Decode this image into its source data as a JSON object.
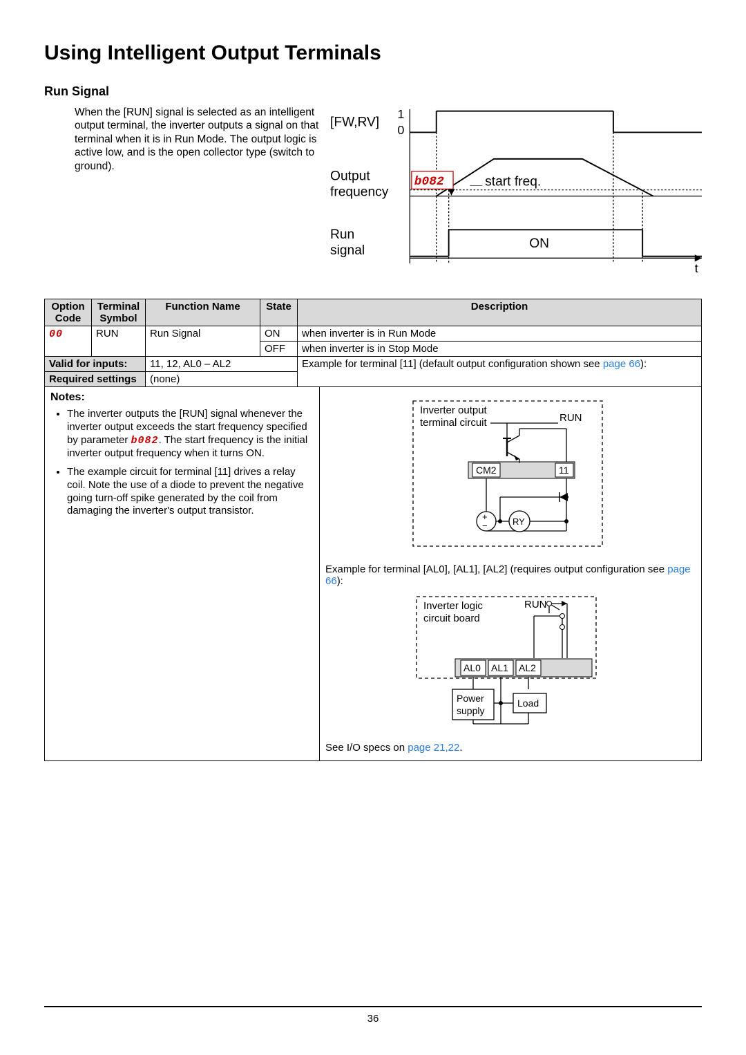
{
  "heading1": "Using Intelligent Output Terminals",
  "heading2": "Run Signal",
  "introText": "When the [RUN] signal is selected as an intelligent output terminal, the inverter outputs a signal on that terminal when it is in Run Mode. The output logic is active low, and is the open collector type (switch to ground).",
  "topDiagram": {
    "fwrv": "[FW,RV]",
    "one": "1",
    "zero": "0",
    "outputFreq": "Output frequency",
    "b082": "b082",
    "startFreq": "start freq.",
    "runSignal": "Run signal",
    "on": "ON",
    "t": "t"
  },
  "table": {
    "headers": {
      "optionCode": "Option Code",
      "terminalSymbol": "Terminal Symbol",
      "functionName": "Function Name",
      "state": "State",
      "description": "Description"
    },
    "row1": {
      "code": "00",
      "symbol": "RUN",
      "funcName": "Run Signal",
      "stateOn": "ON",
      "descOn": "when inverter is in Run Mode"
    },
    "row2": {
      "stateOff": "OFF",
      "descOff": "when inverter is in Stop Mode"
    },
    "validLabel": "Valid for inputs:",
    "validValue": "11, 12, AL0 – AL2",
    "reqLabel": "Required settings",
    "reqValue": "(none)",
    "exampleText1a": "Example for terminal [11] (default output configuration shown see ",
    "exampleText1b": "page 66",
    "exampleText1c": "):"
  },
  "notes": {
    "label": "Notes:",
    "n1a": "The inverter outputs the [RUN] signal whenever the inverter output exceeds the start frequency specified by parameter ",
    "n1b": "b082",
    "n1c": ". The start frequency is the initial inverter output frequency when it turns ON.",
    "n2": "The example circuit for terminal [11] drives a relay coil. Note the use of a diode to prevent the negative going turn-off spike generated by the coil from damaging the inverter's output transistor."
  },
  "circuit1": {
    "invOut": "Inverter output terminal circuit",
    "run": "RUN",
    "cm2": "CM2",
    "eleven": "11",
    "ry": "RY",
    "plus": "+",
    "minus": "−"
  },
  "example2": {
    "text1": "Example for terminal [AL0], [AL1], [AL2] (requires output configuration see ",
    "link": "page 66",
    "text2": "):"
  },
  "circuit2": {
    "invLogic": "Inverter logic circuit board",
    "run": "RUN",
    "al0": "AL0",
    "al1": "AL1",
    "al2": "AL2",
    "power": "Power supply",
    "load": "Load"
  },
  "ioSpecs": {
    "text": "See I/O specs on ",
    "link": "page 21,22",
    "end": "."
  },
  "pageNum": "36"
}
